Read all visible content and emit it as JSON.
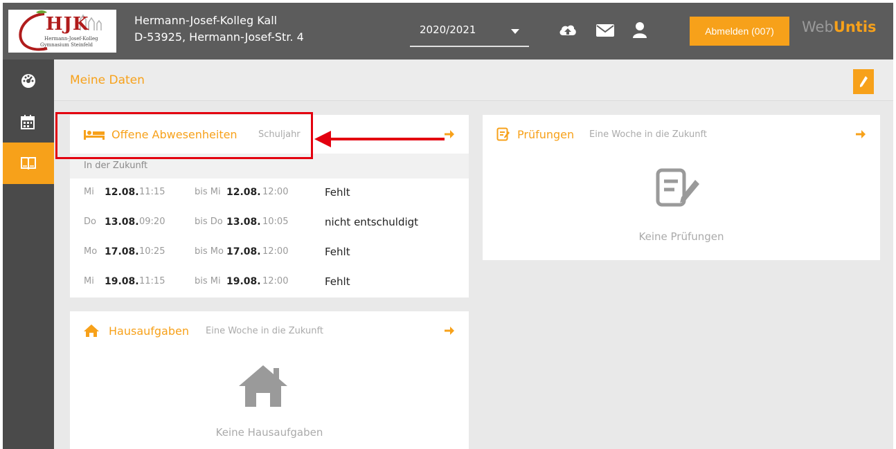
{
  "header": {
    "logo": {
      "text": "HJK",
      "sub1": "Hermann-Josef-Kolleg",
      "sub2": "Gymnasium Steinfeld"
    },
    "school_name": "Hermann-Josef-Kolleg Kall",
    "school_address": "D-53925, Hermann-Josef-Str. 4",
    "school_year": "2020/2021",
    "logout_label": "Abmelden (007)",
    "brand_web": "Web",
    "brand_untis": "Untis",
    "icons": [
      "cloud-upload-icon",
      "mail-icon",
      "user-icon"
    ]
  },
  "sidebar": {
    "items": [
      {
        "icon": "dashboard-icon",
        "active": false
      },
      {
        "icon": "calendar-icon",
        "active": false
      },
      {
        "icon": "book-icon",
        "active": true
      }
    ]
  },
  "page": {
    "title": "Meine Daten"
  },
  "absences": {
    "title": "Offene Abwesenheiten",
    "subtitle": "Schuljahr",
    "section": "In der Zukunft",
    "rows": [
      {
        "from_day": "Mi",
        "from_date": "12.08.",
        "from_time": "11:15",
        "to_prefix": "bis Mi",
        "to_date": "12.08.",
        "to_time": "12:00",
        "status": "Fehlt"
      },
      {
        "from_day": "Do",
        "from_date": "13.08.",
        "from_time": "09:20",
        "to_prefix": "bis Do",
        "to_date": "13.08.",
        "to_time": "10:05",
        "status": "nicht entschuldigt"
      },
      {
        "from_day": "Mo",
        "from_date": "17.08.",
        "from_time": "10:25",
        "to_prefix": "bis Mo",
        "to_date": "17.08.",
        "to_time": "12:00",
        "status": "Fehlt"
      },
      {
        "from_day": "Mi",
        "from_date": "19.08.",
        "from_time": "11:15",
        "to_prefix": "bis Mi",
        "to_date": "19.08.",
        "to_time": "12:00",
        "status": "Fehlt"
      }
    ]
  },
  "exams": {
    "title": "Prüfungen",
    "subtitle": "Eine Woche in die Zukunft",
    "empty": "Keine Prüfungen"
  },
  "homework": {
    "title": "Hausaufgaben",
    "subtitle": "Eine Woche in die Zukunft",
    "empty": "Keine Hausaufgaben"
  },
  "colors": {
    "accent": "#f7a11a",
    "header": "#5c5c5c",
    "sidebar": "#4a4a4a",
    "annotation": "#e3000f"
  }
}
